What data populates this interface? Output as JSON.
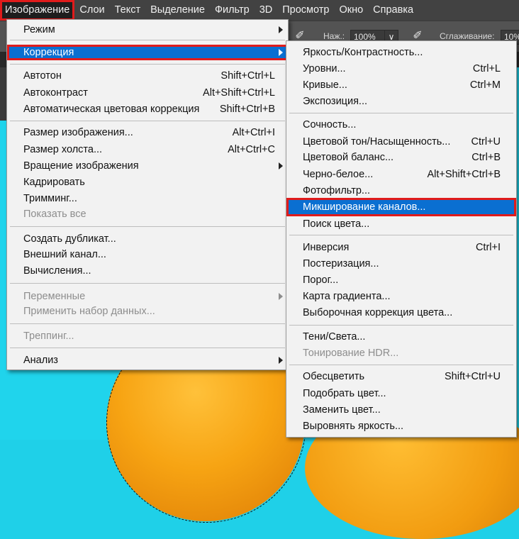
{
  "menubar": {
    "items": [
      "Изображение",
      "Слои",
      "Текст",
      "Выделение",
      "Фильтр",
      "3D",
      "Просмотр",
      "Окно",
      "Справка"
    ]
  },
  "options": {
    "opacity_label": "Наж.:",
    "opacity_value": "100%",
    "smoothing_label": "Сглаживание:",
    "smoothing_value": "10%"
  },
  "image_menu": {
    "mode": {
      "label": "Режим"
    },
    "adjustments": {
      "label": "Коррекция"
    },
    "auto_tone": {
      "label": "Автотон",
      "shortcut": "Shift+Ctrl+L"
    },
    "auto_contrast": {
      "label": "Автоконтраст",
      "shortcut": "Alt+Shift+Ctrl+L"
    },
    "auto_color": {
      "label": "Автоматическая цветовая коррекция",
      "shortcut": "Shift+Ctrl+B"
    },
    "image_size": {
      "label": "Размер изображения...",
      "shortcut": "Alt+Ctrl+I"
    },
    "canvas_size": {
      "label": "Размер холста...",
      "shortcut": "Alt+Ctrl+C"
    },
    "rotation": {
      "label": "Вращение изображения"
    },
    "crop": {
      "label": "Кадрировать"
    },
    "trim": {
      "label": "Тримминг..."
    },
    "reveal_all": {
      "label": "Показать все"
    },
    "duplicate": {
      "label": "Создать дубликат..."
    },
    "apply_image": {
      "label": "Внешний канал..."
    },
    "calculations": {
      "label": "Вычисления..."
    },
    "variables": {
      "label": "Переменные"
    },
    "apply_data_set": {
      "label": "Применить набор данных..."
    },
    "trap": {
      "label": "Треппинг..."
    },
    "analysis": {
      "label": "Анализ"
    }
  },
  "adjust_menu": {
    "brightness": {
      "label": "Яркость/Контрастность..."
    },
    "levels": {
      "label": "Уровни...",
      "shortcut": "Ctrl+L"
    },
    "curves": {
      "label": "Кривые...",
      "shortcut": "Ctrl+M"
    },
    "exposure": {
      "label": "Экспозиция..."
    },
    "vibrance": {
      "label": "Сочность..."
    },
    "hue_sat": {
      "label": "Цветовой тон/Насыщенность...",
      "shortcut": "Ctrl+U"
    },
    "color_balance": {
      "label": "Цветовой баланс...",
      "shortcut": "Ctrl+B"
    },
    "bw": {
      "label": "Черно-белое...",
      "shortcut": "Alt+Shift+Ctrl+B"
    },
    "photo_filter": {
      "label": "Фотофильтр..."
    },
    "channel_mixer": {
      "label": "Микширование каналов..."
    },
    "color_lookup": {
      "label": "Поиск цвета..."
    },
    "invert": {
      "label": "Инверсия",
      "shortcut": "Ctrl+I"
    },
    "posterize": {
      "label": "Постеризация..."
    },
    "threshold": {
      "label": "Порог..."
    },
    "gradient_map": {
      "label": "Карта градиента..."
    },
    "selective_color": {
      "label": "Выборочная коррекция цвета..."
    },
    "shadows_highlights": {
      "label": "Тени/Света..."
    },
    "hdr_toning": {
      "label": "Тонирование HDR..."
    },
    "desaturate": {
      "label": "Обесцветить",
      "shortcut": "Shift+Ctrl+U"
    },
    "match_color": {
      "label": "Подобрать цвет..."
    },
    "replace_color": {
      "label": "Заменить цвет..."
    },
    "equalize": {
      "label": "Выровнять яркость..."
    }
  }
}
